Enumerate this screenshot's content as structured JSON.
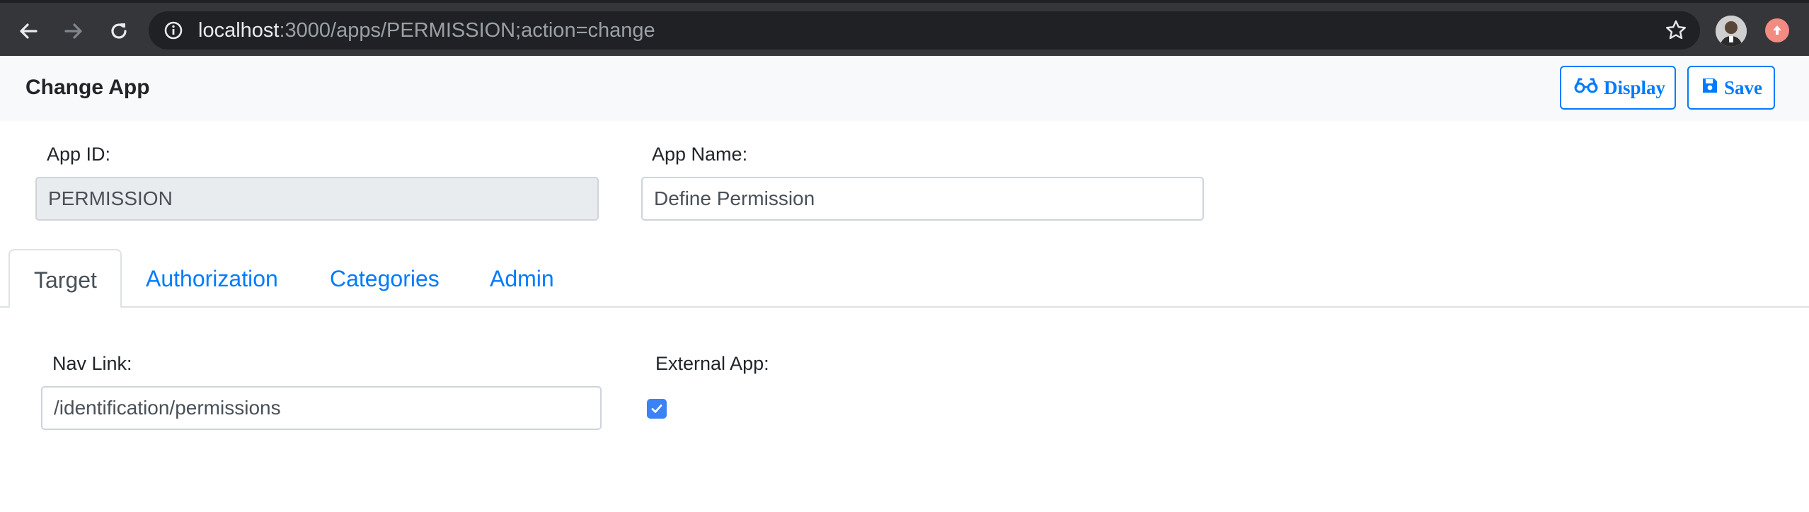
{
  "browser": {
    "url_host": "localhost",
    "url_rest": ":3000/apps/PERMISSION;action=change",
    "icons": [
      "back-icon",
      "forward-icon",
      "reload-icon",
      "info-icon",
      "star-icon",
      "profile-avatar",
      "extension-icon"
    ]
  },
  "header": {
    "title": "Change App",
    "display_label": "Display",
    "save_label": "Save",
    "accent": "#007bff"
  },
  "form": {
    "app_id_label": "App ID:",
    "app_id_value": "PERMISSION",
    "app_name_label": "App Name:",
    "app_name_value": "Define Permission"
  },
  "tabs": [
    {
      "label": "Target",
      "active": true
    },
    {
      "label": "Authorization",
      "active": false
    },
    {
      "label": "Categories",
      "active": false
    },
    {
      "label": "Admin",
      "active": false
    }
  ],
  "target": {
    "nav_link_label": "Nav Link:",
    "nav_link_value": "/identification/permissions",
    "external_app_label": "External App:",
    "external_app_checked": true
  }
}
